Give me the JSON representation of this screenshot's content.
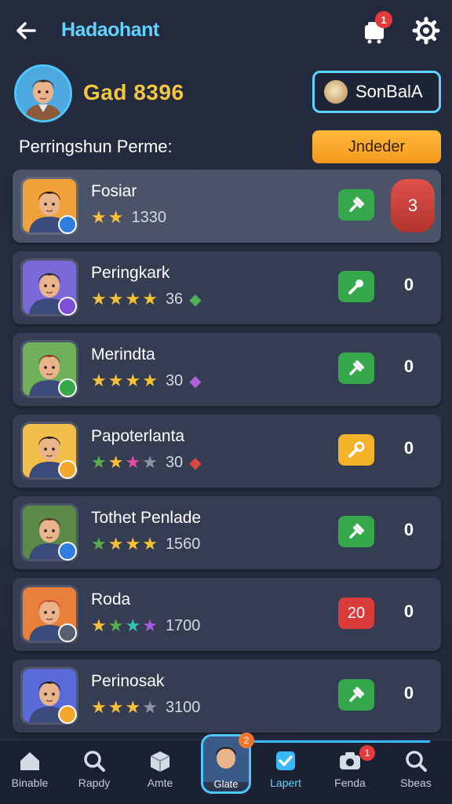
{
  "header": {
    "title": "Hadaohant",
    "back_icon": "arrow-left-icon",
    "cart_badge": "1",
    "settings_icon": "gear-icon"
  },
  "profile": {
    "name": "Gad 8396",
    "scan_button_label": "SonBalA"
  },
  "section": {
    "title": "Perringshun Perme:",
    "update_button_label": "Jndeder"
  },
  "rows": [
    {
      "name": "Fosiar",
      "stars_label": "1330",
      "count": "3",
      "action": "green",
      "stars": [
        "gold",
        "gold"
      ],
      "extra_icon": "",
      "highlighted": true
    },
    {
      "name": "Peringkark",
      "stars_label": "36",
      "count": "0",
      "action": "green-key",
      "stars": [
        "gold",
        "gold",
        "gold",
        "gold"
      ],
      "extra_icon": "gem-green",
      "highlighted": false
    },
    {
      "name": "Merindta",
      "stars_label": "30",
      "count": "0",
      "action": "green",
      "stars": [
        "gold",
        "gold",
        "gold",
        "gold"
      ],
      "extra_icon": "gem-purple",
      "highlighted": false
    },
    {
      "name": "Papoterlanta",
      "stars_label": "30",
      "count": "0",
      "action": "yellow",
      "stars": [
        "green",
        "gold",
        "pink",
        "grey"
      ],
      "extra_icon": "gem-red",
      "highlighted": false
    },
    {
      "name": "Tothet Penlade",
      "stars_label": "1560",
      "count": "0",
      "action": "green",
      "stars": [
        "green",
        "gold",
        "gold",
        "gold"
      ],
      "extra_icon": "",
      "highlighted": false
    },
    {
      "name": "Roda",
      "stars_label": "1700",
      "count": "0",
      "action": "red",
      "action_label": "20",
      "stars": [
        "gold",
        "green",
        "teal",
        "purple"
      ],
      "extra_icon": "",
      "highlighted": false
    },
    {
      "name": "Perinosak",
      "stars_label": "3100",
      "count": "0",
      "action": "green",
      "stars": [
        "gold",
        "gold",
        "gold",
        "grey"
      ],
      "extra_icon": "",
      "highlighted": false
    }
  ],
  "nav": {
    "items": [
      {
        "label": "Binable",
        "icon": "home-icon"
      },
      {
        "label": "Rapdy",
        "icon": "search-icon"
      },
      {
        "label": "Amte",
        "icon": "box-icon"
      },
      {
        "label": "Glate",
        "icon": "character-icon",
        "badge": "2"
      },
      {
        "label": "Lapert",
        "icon": "check-icon"
      },
      {
        "label": "Fenda",
        "icon": "camera-icon",
        "badge": "1"
      },
      {
        "label": "Sbeas",
        "icon": "search-icon"
      }
    ]
  },
  "colors": {
    "accent": "#5fd3ff",
    "gold": "#f5c640",
    "orange_button": "#f59a1c",
    "green_action": "#35a84b",
    "red_badge": "#e53a3a"
  }
}
